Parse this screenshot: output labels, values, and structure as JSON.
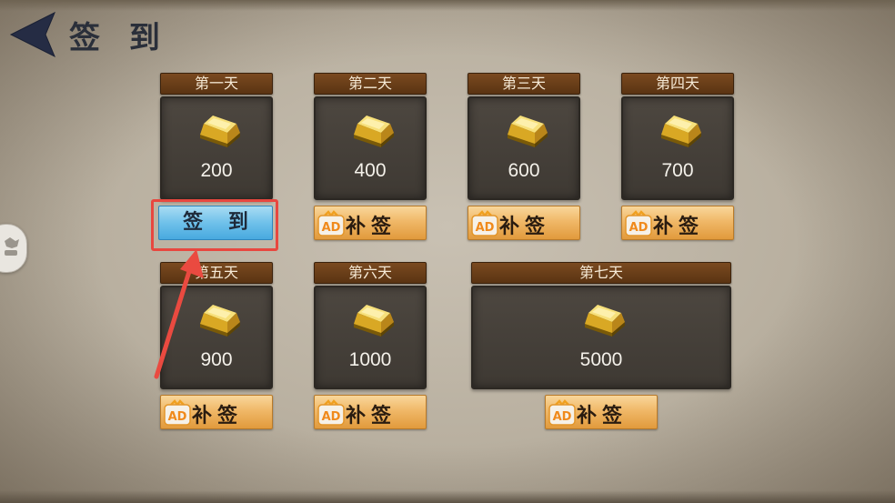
{
  "header": {
    "title": "签 到",
    "back_icon": "back-arrow-icon"
  },
  "days": [
    {
      "label": "第一天",
      "amount": "200",
      "action": "签 到",
      "status": "available"
    },
    {
      "label": "第二天",
      "amount": "400",
      "action": "补签",
      "status": "makeup"
    },
    {
      "label": "第三天",
      "amount": "600",
      "action": "补签",
      "status": "makeup"
    },
    {
      "label": "第四天",
      "amount": "700",
      "action": "补签",
      "status": "makeup"
    },
    {
      "label": "第五天",
      "amount": "900",
      "action": "补签",
      "status": "makeup"
    },
    {
      "label": "第六天",
      "amount": "1000",
      "action": "补签",
      "status": "makeup"
    },
    {
      "label": "第七天",
      "amount": "5000",
      "action": "补签",
      "status": "makeup"
    }
  ],
  "ad_badge": "AD",
  "reward_icon": "gold-bar-icon",
  "colors": {
    "header_brown": "#6a3e18",
    "checkin_blue": "#6fc1ea",
    "makeup_orange": "#f0b868",
    "highlight_red": "#e8473f"
  }
}
